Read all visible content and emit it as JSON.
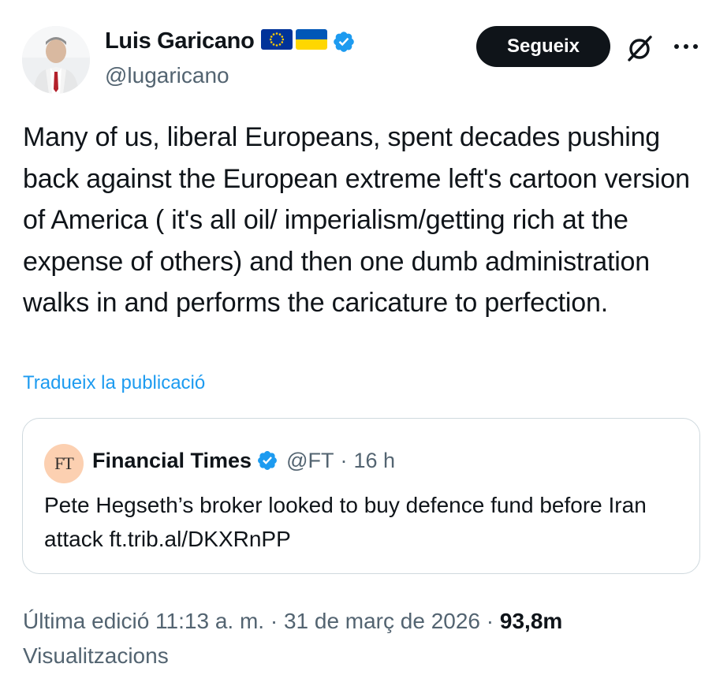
{
  "author": {
    "display_name": "Luis Garicano",
    "handle": "@lugaricano",
    "flags": [
      "eu-flag-icon",
      "ukraine-flag-icon"
    ],
    "verified_icon": "verified-badge-icon"
  },
  "actions": {
    "follow_label": "Segueix",
    "grok_icon": "grok-icon",
    "more_icon": "more-options-icon"
  },
  "tweet": {
    "text": "Many of us, liberal Europeans, spent decades pushing back against the European extreme left's cartoon version of America ( it's all oil/ imperialism/getting rich at the expense of others) and then one dumb administration walks in and performs the caricature to perfection.",
    "translate_label": "Tradueix la publicació"
  },
  "quote": {
    "logo_text": "FT",
    "name": "Financial Times",
    "handle": "@FT",
    "separator": "·",
    "time": "16 h",
    "text": "Pete Hegseth’s broker looked to buy defence fund before Iran attack ft.trib.al/DKXRnPP"
  },
  "footer": {
    "edited_label": "Última edició 11:13 a. m. · 31 de març de 2026 ·",
    "views_count": "93,8m",
    "views_label": "Visualitzacions"
  },
  "colors": {
    "accent_blue": "#1d9bf0",
    "text_primary": "#0f1419",
    "text_secondary": "#536471",
    "border": "#cfd9de",
    "ft_logo_bg": "#fcd0b1",
    "eu_blue": "#003399",
    "eu_stars": "#ffcc00",
    "ukraine_blue": "#0057b7",
    "ukraine_yellow": "#ffd700"
  }
}
